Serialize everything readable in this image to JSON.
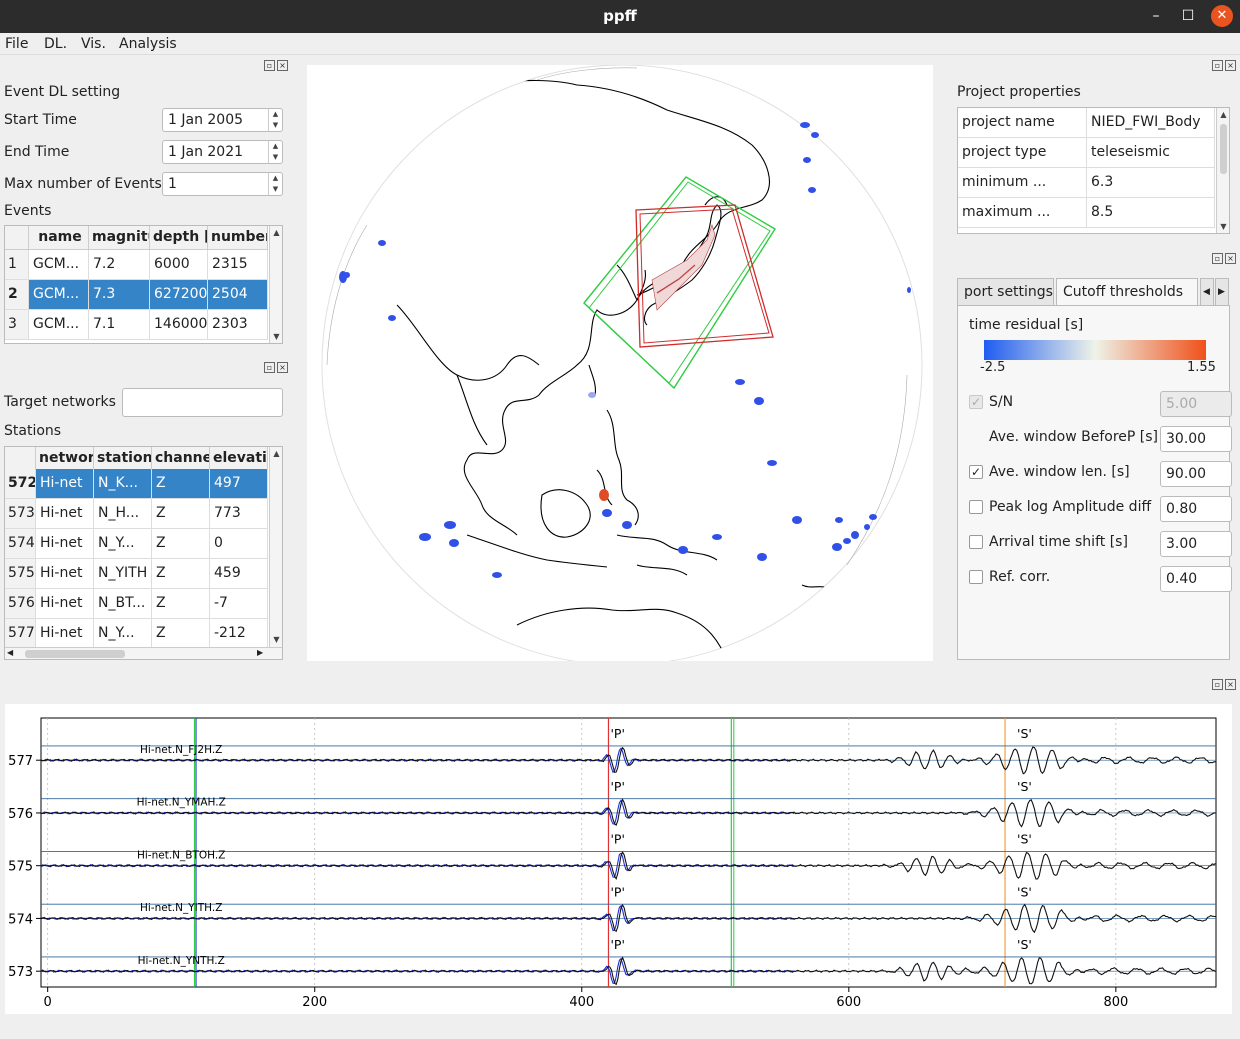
{
  "window": {
    "title": "ppff",
    "minimize": "–",
    "maximize": "☐",
    "close": "✕"
  },
  "menu": {
    "file": "File",
    "dl": "DL.",
    "vis": "Vis.",
    "analysis": "Analysis"
  },
  "event_dl": {
    "heading": "Event DL setting",
    "start_label": "Start Time",
    "start_value": "1 Jan 2005",
    "end_label": "End Time",
    "end_value": "1 Jan 2021",
    "max_label": "Max number of Events",
    "max_value": "1",
    "events_label": "Events",
    "columns": [
      "name",
      "magnitude",
      "depth [m]",
      "number of tr"
    ],
    "rows": [
      {
        "idx": "1",
        "name": "GCM...",
        "mag": "7.2",
        "depth": "6000",
        "ntr": "2315"
      },
      {
        "idx": "2",
        "name": "GCM...",
        "mag": "7.3",
        "depth": "627200",
        "ntr": "2504"
      },
      {
        "idx": "3",
        "name": "GCM...",
        "mag": "7.1",
        "depth": "146000",
        "ntr": "2303"
      }
    ]
  },
  "stations": {
    "target_label": "Target networks",
    "target_value": "",
    "label": "Stations",
    "columns": [
      "network",
      "station",
      "channel",
      "elevation"
    ],
    "rows": [
      {
        "idx": "572",
        "net": "Hi-net",
        "sta": "N_K...",
        "ch": "Z",
        "elev": "497"
      },
      {
        "idx": "573",
        "net": "Hi-net",
        "sta": "N_H...",
        "ch": "Z",
        "elev": "773"
      },
      {
        "idx": "574",
        "net": "Hi-net",
        "sta": "N_Y...",
        "ch": "Z",
        "elev": "0"
      },
      {
        "idx": "575",
        "net": "Hi-net",
        "sta": "N_YITH",
        "ch": "Z",
        "elev": "459"
      },
      {
        "idx": "576",
        "net": "Hi-net",
        "sta": "N_BT...",
        "ch": "Z",
        "elev": "-7"
      },
      {
        "idx": "577",
        "net": "Hi-net",
        "sta": "N_Y...",
        "ch": "Z",
        "elev": "-212"
      }
    ]
  },
  "project": {
    "heading": "Project properties",
    "rows": [
      {
        "key": "project name",
        "value": "NIED_FWI_Body"
      },
      {
        "key": "project type",
        "value": "teleseismic"
      },
      {
        "key": "minimum ...",
        "value": "6.3"
      },
      {
        "key": "maximum ...",
        "value": "8.5"
      }
    ]
  },
  "thresholds": {
    "tab_prev": "port settings",
    "tab_active": "Cutoff thresholds",
    "colorbar_label": "time residual [s]",
    "colorbar_min": "-2.5",
    "colorbar_max": "1.55",
    "colors": {
      "low": "#1f5cf0",
      "mid": "#eef3e8",
      "high": "#f0501a"
    },
    "options": [
      {
        "label": "S/N",
        "checked": true,
        "enabled": false,
        "value": "5.00"
      },
      {
        "label": "Ave. window BeforeP [s]",
        "checked": null,
        "enabled": true,
        "value": "30.00"
      },
      {
        "label": "Ave. window len. [s]",
        "checked": true,
        "enabled": true,
        "value": "90.00"
      },
      {
        "label": "Peak log Amplitude diff",
        "checked": false,
        "enabled": true,
        "value": "0.80"
      },
      {
        "label": "Arrival time shift [s]",
        "checked": false,
        "enabled": true,
        "value": "3.00"
      },
      {
        "label": "Ref. corr.",
        "checked": false,
        "enabled": true,
        "value": "0.40"
      }
    ]
  },
  "chart_data": {
    "type": "line",
    "xlim": [
      -5,
      875
    ],
    "ylim": [
      572.7,
      577.8
    ],
    "xticks": [
      0,
      200,
      400,
      600,
      800
    ],
    "yticks": [
      577,
      576,
      575,
      574,
      573
    ],
    "traces": [
      {
        "offset": 577,
        "label": "Hi-net.N_FJ2H.Z"
      },
      {
        "offset": 576,
        "label": "Hi-net.N_YMAH.Z"
      },
      {
        "offset": 575,
        "label": "Hi-net.N_BTOH.Z"
      },
      {
        "offset": 574,
        "label": "Hi-net.N_YITH.Z"
      },
      {
        "offset": 573,
        "label": "Hi-net.N_YNTH.Z"
      }
    ],
    "phase_label_p": "'P'",
    "phase_label_s": "'S'",
    "markers": {
      "window_start": 110,
      "p_pick": 420,
      "window_end": 512,
      "s_pick": 717
    },
    "colors": {
      "trace": "#111111",
      "synthetic": "#1b2fd6",
      "p": "#e33030",
      "s": "#f0a040",
      "window": "#2ecc40"
    }
  }
}
